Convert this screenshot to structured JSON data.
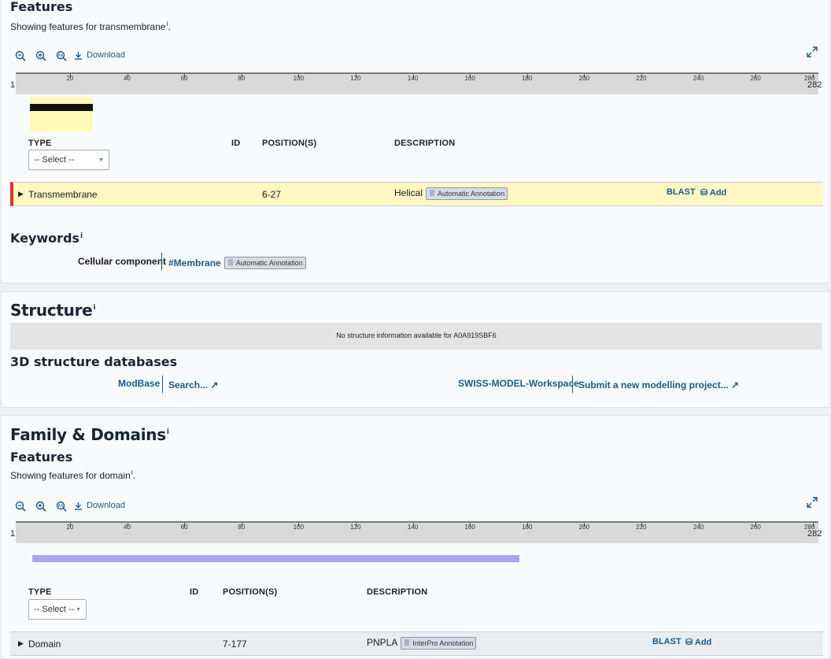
{
  "features1": {
    "title": "Features",
    "subtitle_prefix": "Showing features for transmembrane",
    "subtitle_suffix": ".",
    "download": "Download",
    "ruler_start": "1",
    "ruler_end": "282",
    "ticks": [
      "20",
      "40",
      "60",
      "80",
      "100",
      "120",
      "140",
      "160",
      "180",
      "200",
      "220",
      "240",
      "260",
      "280"
    ],
    "columns": {
      "type": "TYPE",
      "id": "ID",
      "positions": "POSITION(S)",
      "description": "DESCRIPTION"
    },
    "select_label": "-- Select --",
    "row": {
      "type": "Transmembrane",
      "id": "",
      "positions": "6-27",
      "description": "Helical",
      "badge": "Automatic Annotation",
      "blast": "BLAST",
      "add": "Add"
    },
    "track_color": "#fff8b8"
  },
  "keywords": {
    "title": "Keywords",
    "label": "Cellular component",
    "value": "#Membrane",
    "badge": "Automatic Annotation"
  },
  "structure": {
    "title": "Structure",
    "notice": "No structure information available for A0A919SBF6",
    "db_title": "3D structure databases",
    "modbase_label": "ModBase",
    "modbase_link": "Search...",
    "swiss_label": "SWISS-MODEL-Workspace",
    "swiss_link": "Submit a new modelling project..."
  },
  "family": {
    "title": "Family & Domains",
    "features_title": "Features",
    "subtitle_prefix": "Showing features for domain",
    "subtitle_suffix": ".",
    "download": "Download",
    "ruler_start": "1",
    "ruler_end": "282",
    "columns": {
      "type": "TYPE",
      "id": "ID",
      "positions": "POSITION(S)",
      "description": "DESCRIPTION"
    },
    "select_label": "-- Select --",
    "row": {
      "type": "Domain",
      "id": "",
      "positions": "7-177",
      "description": "PNPLA",
      "badge": "InterPro Annotation",
      "blast": "BLAST",
      "add": "Add"
    },
    "track_color": "#a9a4f5"
  },
  "info_glyph": "i"
}
